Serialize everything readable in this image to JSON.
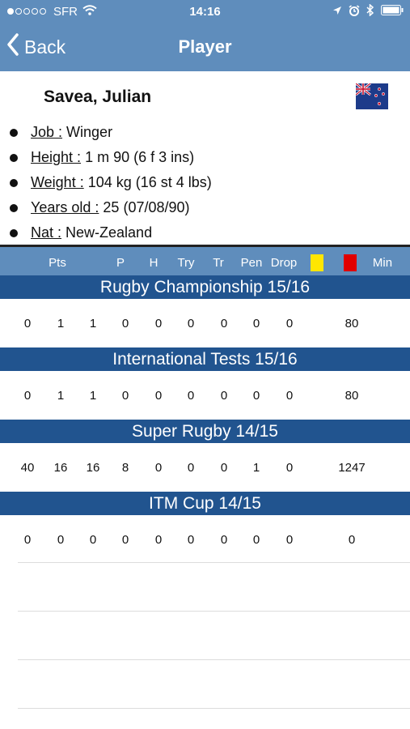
{
  "status_bar": {
    "carrier": "SFR",
    "time": "14:16",
    "signal_icon": "signal-dots-icon",
    "wifi_icon": "wifi-icon"
  },
  "nav": {
    "back_label": "Back",
    "title": "Player"
  },
  "player": {
    "name": "Savea, Julian",
    "flag_icon": "new-zealand-flag-icon",
    "attributes": [
      {
        "key": "Job :",
        "value": "Winger"
      },
      {
        "key": "Height :",
        "value": "1 m 90 (6 f 3 ins)"
      },
      {
        "key": "Weight :",
        "value": "104 kg (16 st 4 lbs)"
      },
      {
        "key": "Years old :",
        "value": "25 (07/08/90)"
      },
      {
        "key": "Nat :",
        "value": "New-Zealand"
      }
    ]
  },
  "stats": {
    "headers": [
      "Pts",
      "P",
      "H",
      "Try",
      "Tr",
      "Pen",
      "Drop",
      "Min"
    ],
    "card_colors": {
      "yellow": "#ffe600",
      "red": "#e00000"
    },
    "sections": [
      {
        "title": "Rugby Championship 15/16",
        "values": [
          "0",
          "1",
          "1",
          "0",
          "0",
          "0",
          "0",
          "0",
          "0",
          "80"
        ]
      },
      {
        "title": "International Tests  15/16",
        "values": [
          "0",
          "1",
          "1",
          "0",
          "0",
          "0",
          "0",
          "0",
          "0",
          "80"
        ]
      },
      {
        "title": "Super Rugby 14/15",
        "values": [
          "40",
          "16",
          "16",
          "8",
          "0",
          "0",
          "0",
          "1",
          "0",
          "1247"
        ]
      },
      {
        "title": "ITM Cup 14/15",
        "values": [
          "0",
          "0",
          "0",
          "0",
          "0",
          "0",
          "0",
          "0",
          "0",
          "0"
        ]
      }
    ]
  },
  "colors": {
    "nav_blue": "#5f8dbc",
    "section_blue": "#21548f"
  }
}
